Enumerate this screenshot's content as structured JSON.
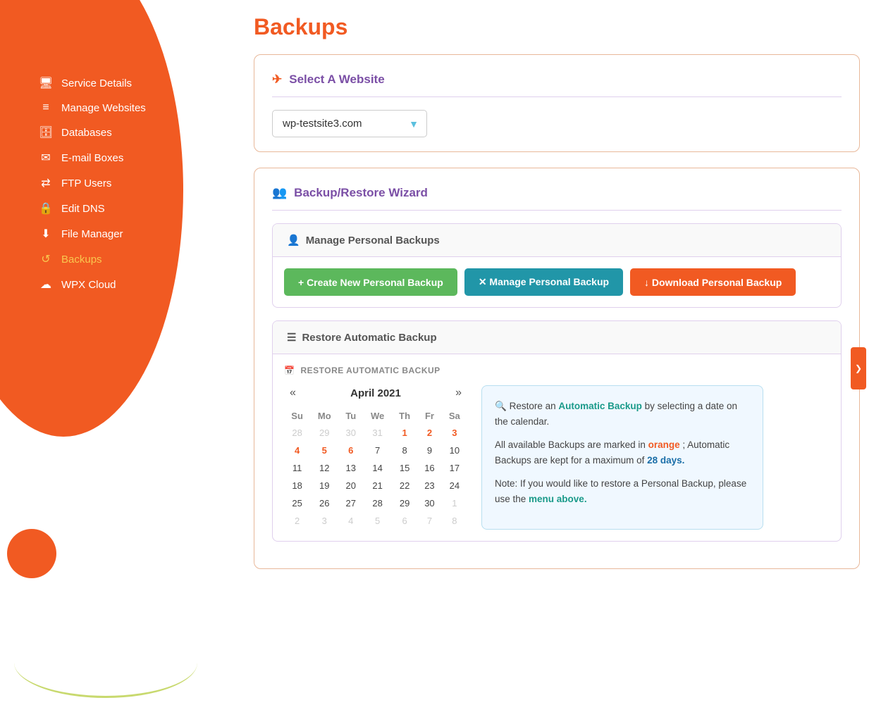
{
  "sidebar": {
    "nav_items": [
      {
        "id": "service-details",
        "label": "Service Details",
        "icon": "🖥",
        "active": false
      },
      {
        "id": "manage-websites",
        "label": "Manage Websites",
        "icon": "≡",
        "active": false
      },
      {
        "id": "databases",
        "label": "Databases",
        "icon": "🗄",
        "active": false
      },
      {
        "id": "email-boxes",
        "label": "E-mail Boxes",
        "icon": "✉",
        "active": false
      },
      {
        "id": "ftp-users",
        "label": "FTP Users",
        "icon": "⇄",
        "active": false
      },
      {
        "id": "edit-dns",
        "label": "Edit DNS",
        "icon": "🔒",
        "active": false
      },
      {
        "id": "file-manager",
        "label": "File Manager",
        "icon": "⬇",
        "active": false
      },
      {
        "id": "backups",
        "label": "Backups",
        "icon": "↺",
        "active": true
      },
      {
        "id": "wpx-cloud",
        "label": "WPX Cloud",
        "icon": "☁",
        "active": false
      }
    ]
  },
  "main": {
    "page_title": "Backups",
    "select_website_label": "Select A Website",
    "website_selected": "wp-testsite3.com",
    "backup_restore_wizard_label": "Backup/Restore Wizard",
    "manage_personal_backups_label": "Manage Personal Backups",
    "create_new_backup_btn": "+ Create New Personal Backup",
    "manage_personal_backup_btn": "✕ Manage Personal Backup",
    "download_personal_backup_btn": "↓ Download Personal Backup",
    "restore_automatic_backup_label": "Restore Automatic Backup",
    "restore_auto_section_title": "RESTORE AUTOMATIC BACKUP",
    "calendar": {
      "month": "April 2021",
      "prev": "«",
      "next": "»",
      "days_of_week": [
        "Su",
        "Mo",
        "Tu",
        "We",
        "Th",
        "Fr",
        "Sa"
      ],
      "weeks": [
        [
          {
            "day": "28",
            "other": true,
            "highlight": false
          },
          {
            "day": "29",
            "other": true,
            "highlight": false
          },
          {
            "day": "30",
            "other": true,
            "highlight": false
          },
          {
            "day": "31",
            "other": true,
            "highlight": false
          },
          {
            "day": "1",
            "other": false,
            "highlight": true
          },
          {
            "day": "2",
            "other": false,
            "highlight": true
          },
          {
            "day": "3",
            "other": false,
            "highlight": true
          }
        ],
        [
          {
            "day": "4",
            "other": false,
            "highlight": true
          },
          {
            "day": "5",
            "other": false,
            "highlight": true
          },
          {
            "day": "6",
            "other": false,
            "highlight": true
          },
          {
            "day": "7",
            "other": false,
            "highlight": false
          },
          {
            "day": "8",
            "other": false,
            "highlight": false
          },
          {
            "day": "9",
            "other": false,
            "highlight": false
          },
          {
            "day": "10",
            "other": false,
            "highlight": false
          }
        ],
        [
          {
            "day": "11",
            "other": false,
            "highlight": false
          },
          {
            "day": "12",
            "other": false,
            "highlight": false
          },
          {
            "day": "13",
            "other": false,
            "highlight": false
          },
          {
            "day": "14",
            "other": false,
            "highlight": false
          },
          {
            "day": "15",
            "other": false,
            "highlight": false
          },
          {
            "day": "16",
            "other": false,
            "highlight": false
          },
          {
            "day": "17",
            "other": false,
            "highlight": false
          }
        ],
        [
          {
            "day": "18",
            "other": false,
            "highlight": false
          },
          {
            "day": "19",
            "other": false,
            "highlight": false
          },
          {
            "day": "20",
            "other": false,
            "highlight": false
          },
          {
            "day": "21",
            "other": false,
            "highlight": false
          },
          {
            "day": "22",
            "other": false,
            "highlight": false
          },
          {
            "day": "23",
            "other": false,
            "highlight": false
          },
          {
            "day": "24",
            "other": false,
            "highlight": false
          }
        ],
        [
          {
            "day": "25",
            "other": false,
            "highlight": false
          },
          {
            "day": "26",
            "other": false,
            "highlight": false
          },
          {
            "day": "27",
            "other": false,
            "highlight": false
          },
          {
            "day": "28",
            "other": false,
            "highlight": false
          },
          {
            "day": "29",
            "other": false,
            "highlight": false
          },
          {
            "day": "30",
            "other": false,
            "highlight": false
          },
          {
            "day": "1",
            "other": true,
            "highlight": false
          }
        ],
        [
          {
            "day": "2",
            "other": true,
            "highlight": false
          },
          {
            "day": "3",
            "other": true,
            "highlight": false
          },
          {
            "day": "4",
            "other": true,
            "highlight": false
          },
          {
            "day": "5",
            "other": true,
            "highlight": false
          },
          {
            "day": "6",
            "other": true,
            "highlight": false
          },
          {
            "day": "7",
            "other": true,
            "highlight": false
          },
          {
            "day": "8",
            "other": true,
            "highlight": false
          }
        ]
      ]
    },
    "info_box": {
      "line1_before": "Restore an ",
      "line1_bold": "Automatic Backup",
      "line1_after": " by selecting a date on the calendar.",
      "line2_before": "All available Backups are marked in ",
      "line2_bold": "orange",
      "line2_after": "; Automatic Backups are kept for a maximum of ",
      "line2_days": "28 days.",
      "line3_before": "Note: If you would like to restore a Personal Backup, please use the ",
      "line3_bold": "menu above."
    }
  }
}
